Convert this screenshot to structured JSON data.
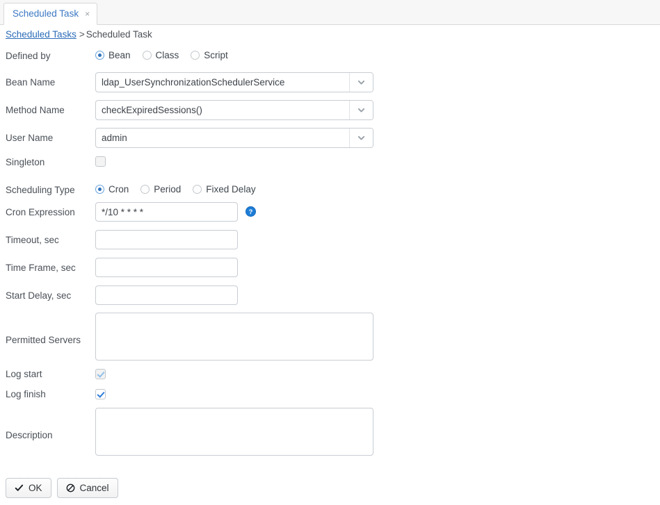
{
  "tab": {
    "label": "Scheduled Task",
    "close": "×"
  },
  "breadcrumb": {
    "parent": "Scheduled Tasks",
    "separator": ">",
    "current": "Scheduled Task"
  },
  "form": {
    "defined_by": {
      "label": "Defined by",
      "options": [
        "Bean",
        "Class",
        "Script"
      ],
      "selected": "Bean"
    },
    "bean_name": {
      "label": "Bean Name",
      "value": "ldap_UserSynchronizationSchedulerService"
    },
    "method_name": {
      "label": "Method Name",
      "value": "checkExpiredSessions()"
    },
    "user_name": {
      "label": "User Name",
      "value": "admin"
    },
    "singleton": {
      "label": "Singleton",
      "checked": false
    },
    "scheduling_type": {
      "label": "Scheduling Type",
      "options": [
        "Cron",
        "Period",
        "Fixed Delay"
      ],
      "selected": "Cron"
    },
    "cron_expression": {
      "label": "Cron Expression",
      "value": "*/10 * * * *",
      "help_icon": "help-circle-icon"
    },
    "timeout_sec": {
      "label": "Timeout, sec",
      "value": ""
    },
    "time_frame_sec": {
      "label": "Time Frame, sec",
      "value": ""
    },
    "start_delay_sec": {
      "label": "Start Delay, sec",
      "value": ""
    },
    "permitted_servers": {
      "label": "Permitted Servers",
      "value": ""
    },
    "log_start": {
      "label": "Log start",
      "checked": true,
      "disabled": true
    },
    "log_finish": {
      "label": "Log finish",
      "checked": true,
      "disabled": false
    },
    "description": {
      "label": "Description",
      "value": ""
    }
  },
  "buttons": {
    "ok": "OK",
    "cancel": "Cancel"
  },
  "colors": {
    "link": "#2b6cb8",
    "tab_text": "#3b78c3",
    "accent": "#2f7ddb",
    "help_icon": "#1d7dd6",
    "field_border": "#c8cdd2"
  }
}
